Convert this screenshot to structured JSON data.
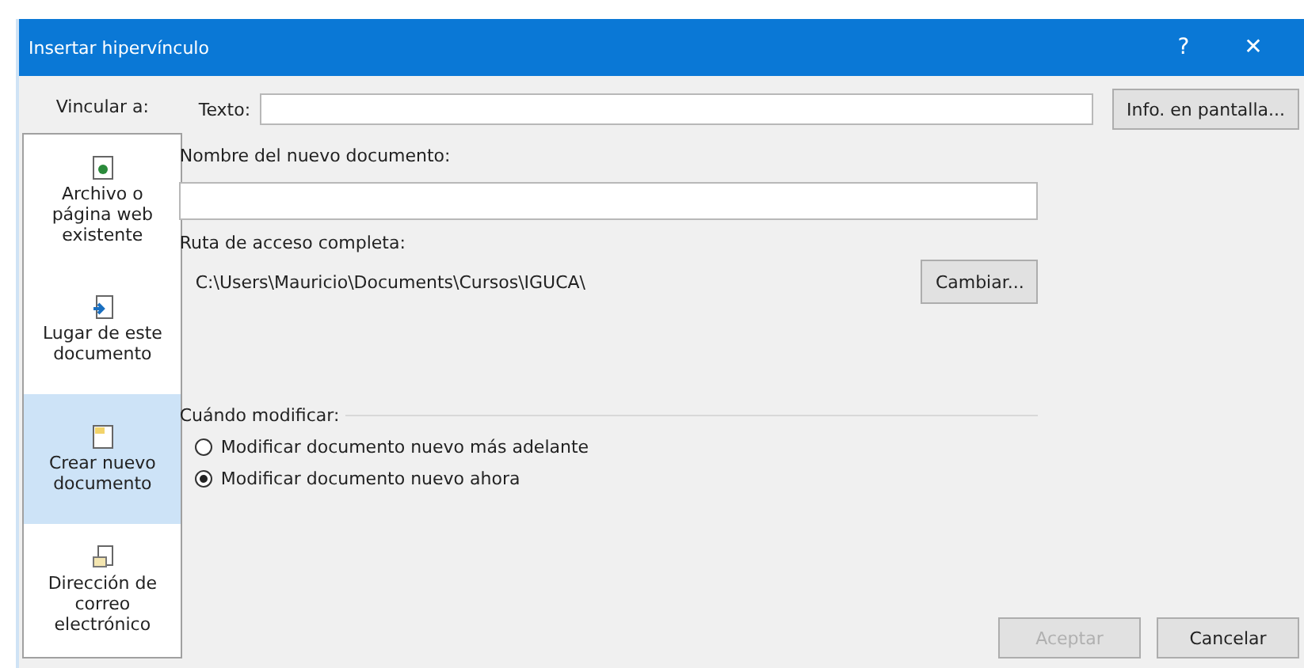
{
  "window": {
    "title": "Insertar hipervínculo",
    "help": "?",
    "close": "✕"
  },
  "sidebar": {
    "heading": "Vincular a:",
    "items": [
      {
        "label": "Archivo o\npágina web\nexistente",
        "kind": "file",
        "selected": false
      },
      {
        "label": "Lugar de este\ndocumento",
        "kind": "place",
        "selected": false
      },
      {
        "label": "Crear nuevo\ndocumento",
        "kind": "new",
        "selected": true
      },
      {
        "label": "Dirección de\ncorreo\nelectrónico",
        "kind": "mail",
        "selected": false
      }
    ]
  },
  "text_field": {
    "label": "Texto:"
  },
  "screentip_button": "Info. en pantalla...",
  "new_doc": {
    "label": "Nombre del nuevo documento:"
  },
  "path": {
    "label": "Ruta de acceso completa:",
    "value": "C:\\Users\\Mauricio\\Documents\\Cursos\\IGUCA\\",
    "button": "Cambiar..."
  },
  "when_edit": {
    "label": "Cuándo modificar:",
    "options": [
      {
        "label": "Modificar documento nuevo más adelante",
        "selected": false
      },
      {
        "label": "Modificar documento nuevo ahora",
        "selected": true
      }
    ]
  },
  "buttons": [
    {
      "label": "Aceptar",
      "disabled": true
    },
    {
      "label": "Cancelar",
      "disabled": false
    }
  ]
}
